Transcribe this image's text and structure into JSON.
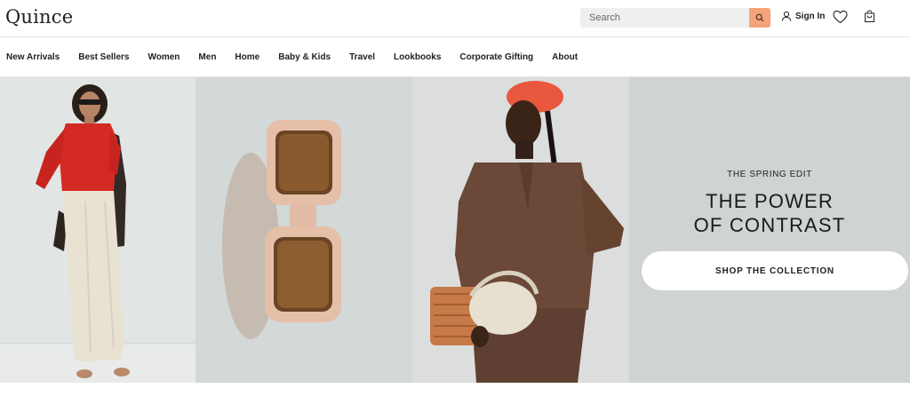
{
  "header": {
    "logo": "Quince",
    "search": {
      "placeholder": "Search"
    },
    "signin_label": "Sign In"
  },
  "nav": {
    "items": [
      "New Arrivals",
      "Best Sellers",
      "Women",
      "Men",
      "Home",
      "Baby & Kids",
      "Travel",
      "Lookbooks",
      "Corporate Gifting",
      "About"
    ]
  },
  "hero": {
    "eyebrow": "THE SPRING EDIT",
    "title_line1": "THE POWER",
    "title_line2": "OF CONTRAST",
    "cta_label": "SHOP THE COLLECTION"
  },
  "colors": {
    "accent": "#f4a37a",
    "sweater": "#d42a24",
    "headscarf": "#e9573f",
    "silk_brown": "#6b4837"
  },
  "icons": [
    "search-icon",
    "user-icon",
    "heart-icon",
    "bag-icon"
  ]
}
